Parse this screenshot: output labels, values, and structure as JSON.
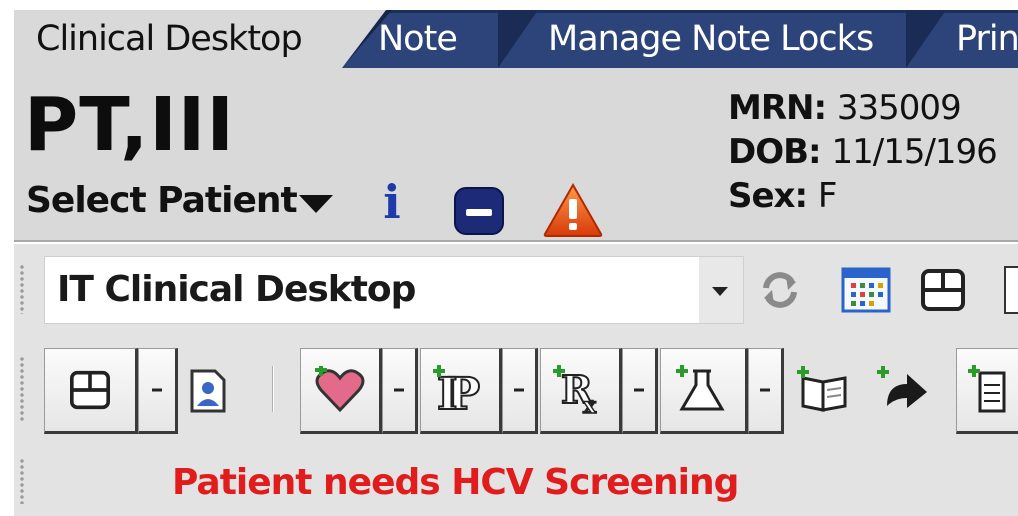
{
  "tabs": [
    {
      "label": "Clinical Desktop",
      "active": true
    },
    {
      "label": "Note",
      "active": false
    },
    {
      "label": "Manage Note Locks",
      "active": false
    },
    {
      "label": "Prin",
      "active": false
    }
  ],
  "patient": {
    "name": "PT,III",
    "select_label": "Select Patient",
    "mrn_label": "MRN:",
    "mrn": "335009",
    "dob_label": "DOB:",
    "dob": "11/15/196",
    "sex_label": "Sex:",
    "sex": "F"
  },
  "icons": {
    "info": "i",
    "info_icon": "info-icon",
    "status_icon": "minus-badge-icon",
    "warning_icon": "warning-triangle-icon"
  },
  "toolbar": {
    "desktop_select_value": "IT Clinical Desktop"
  },
  "alert": {
    "message": "Patient needs HCV Screening",
    "color": "#e11c1c"
  },
  "colors": {
    "tab_bar": "#2c4479",
    "active_tab": "#d9d9d9",
    "header_bg": "#d9d9d9",
    "info_blue": "#1d3aa8",
    "badge_navy": "#1d2a78"
  }
}
